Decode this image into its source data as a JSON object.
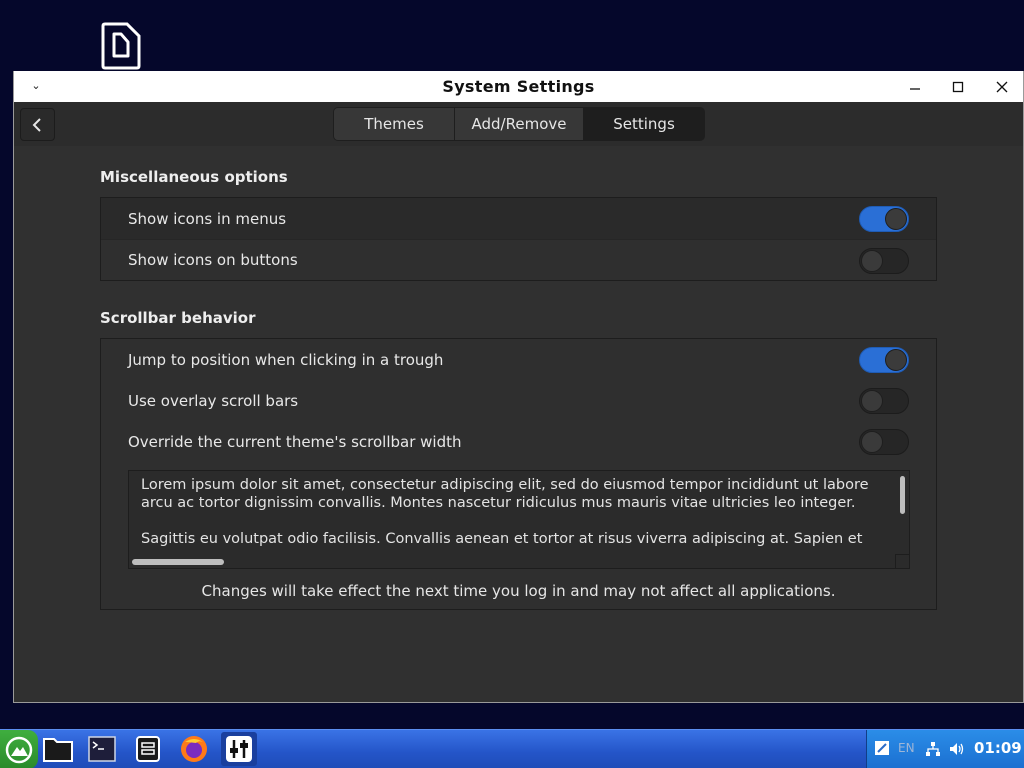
{
  "window": {
    "title": "System Settings",
    "menu_glyph": "⌄"
  },
  "tabs": [
    {
      "label": "Themes",
      "active": false
    },
    {
      "label": "Add/Remove",
      "active": false
    },
    {
      "label": "Settings",
      "active": true
    }
  ],
  "misc": {
    "title": "Miscellaneous options",
    "options": [
      {
        "label": "Show icons in menus",
        "enabled": true
      },
      {
        "label": "Show icons on buttons",
        "enabled": false
      }
    ]
  },
  "scrollbar": {
    "title": "Scrollbar behavior",
    "options": [
      {
        "label": "Jump to position when clicking in a trough",
        "enabled": true
      },
      {
        "label": "Use overlay scroll bars",
        "enabled": false
      },
      {
        "label": "Override the current theme's scrollbar width",
        "enabled": false
      }
    ],
    "sample_text": [
      "Lorem ipsum dolor sit amet, consectetur adipiscing elit, sed do eiusmod tempor incididunt ut labore",
      "arcu ac tortor dignissim convallis. Montes nascetur ridiculus mus mauris vitae ultricies leo integer.",
      "Sagittis eu volutpat odio facilisis. Convallis aenean et tortor at risus viverra adipiscing at. Sapien et"
    ]
  },
  "note": "Changes will take effect the next time you log in and may not affect all applications.",
  "taskbar": {
    "apps": [
      "file-manager-icon",
      "terminal-icon",
      "archive-icon",
      "firefox-icon",
      "settings-icon"
    ],
    "language": "EN",
    "clock": "01:09"
  },
  "colors": {
    "accent": "#2a6fd6",
    "window_bg": "#303030",
    "desktop_bg": "#05072b",
    "taskbar": "#2455c8"
  }
}
